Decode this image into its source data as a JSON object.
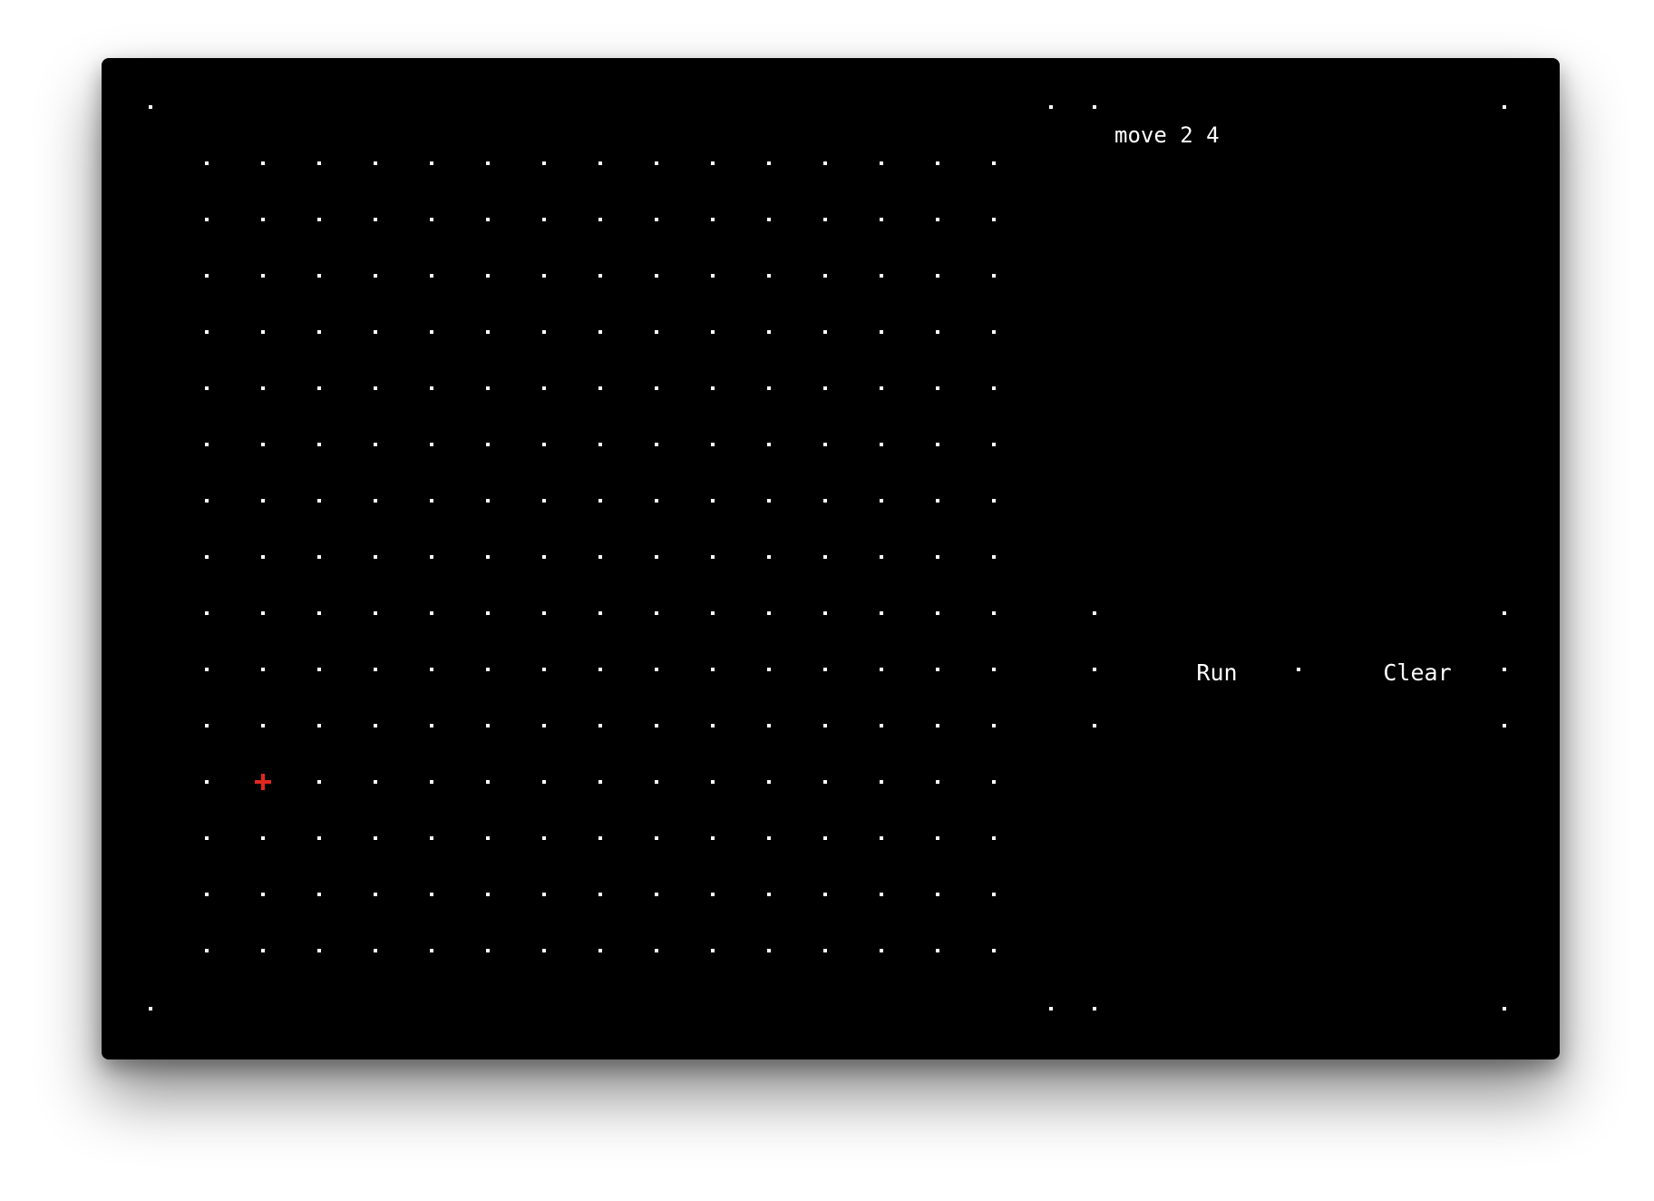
{
  "editor": {
    "command_text": "move 2 4"
  },
  "controls": {
    "run_label": "Run",
    "clear_label": "Clear"
  },
  "grid": {
    "columns": 15,
    "rows": 15,
    "cursor_column": 2,
    "cursor_row": 12
  },
  "colors": {
    "background": "#000000",
    "dot": "#ffffff",
    "cursor": "#e0281e"
  }
}
